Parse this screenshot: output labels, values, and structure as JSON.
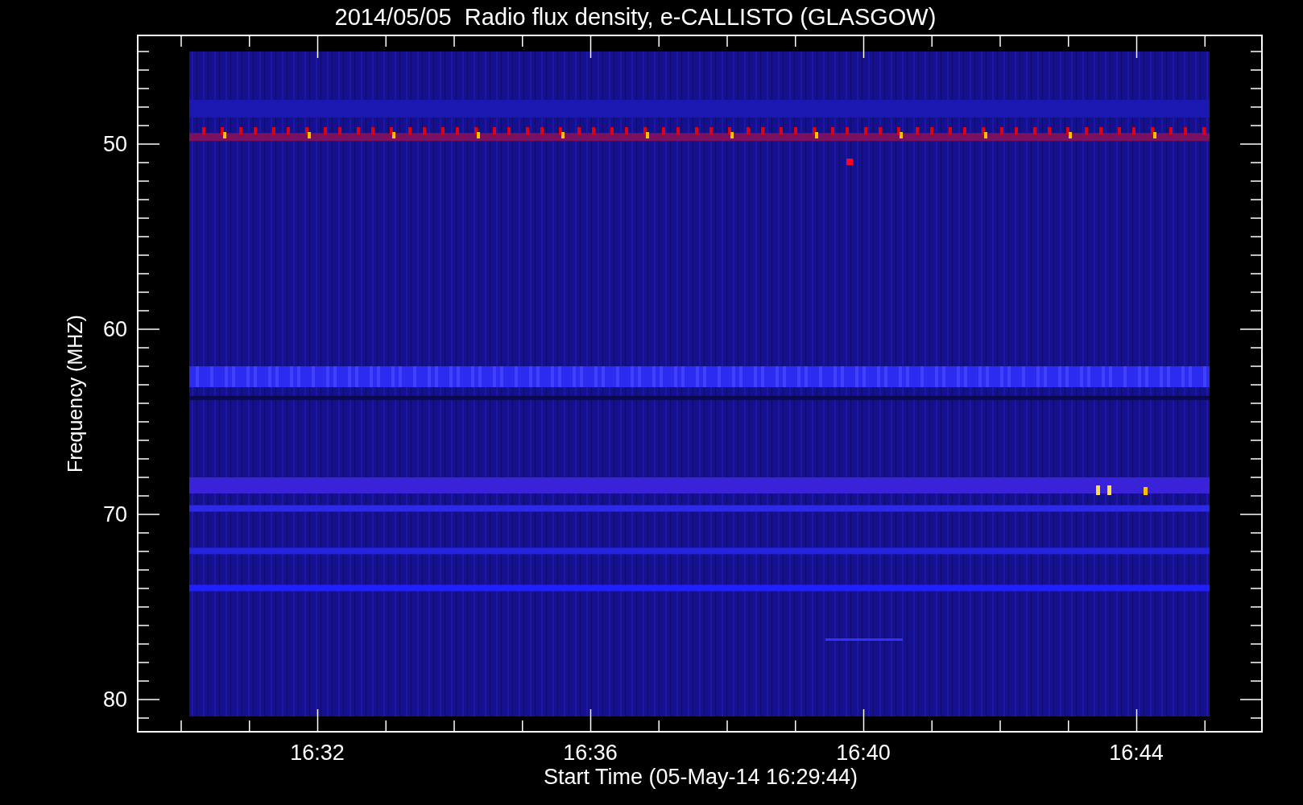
{
  "title": "2014/05/05  Radio flux density, e-CALLISTO (GLASGOW)",
  "y_axis": {
    "label": "Frequency (MHZ)",
    "ticks": [
      "50",
      "60",
      "70",
      "80"
    ]
  },
  "x_axis": {
    "label": "Start Time (05-May-14 16:29:44)",
    "ticks": [
      "16:32",
      "16:36",
      "16:40",
      "16:44"
    ]
  }
}
